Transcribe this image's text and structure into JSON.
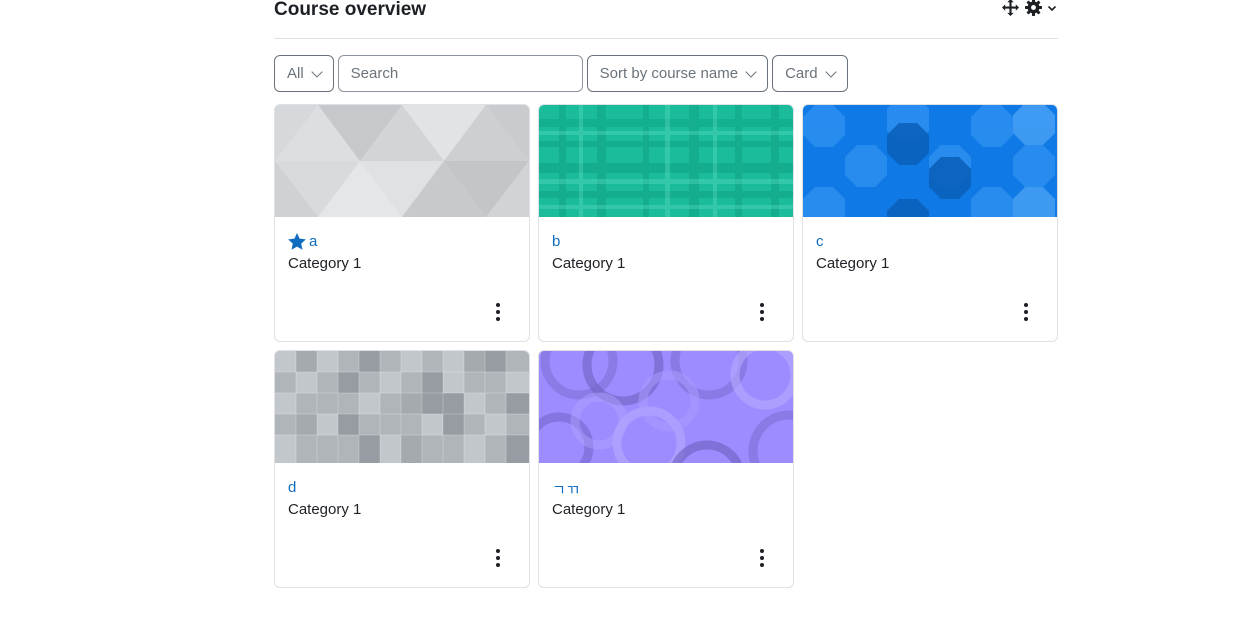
{
  "block": {
    "title": "Course overview",
    "controls": {
      "move_icon": "move-icon",
      "settings_icon": "gear-icon"
    }
  },
  "filters": {
    "grouping_label": "All",
    "search_placeholder": "Search",
    "sort_label": "Sort by course name",
    "view_label": "Card"
  },
  "courses": [
    {
      "name": "a",
      "category": "Category 1",
      "starred": true,
      "pattern": "triangles"
    },
    {
      "name": "b",
      "category": "Category 1",
      "starred": false,
      "pattern": "plaid"
    },
    {
      "name": "c",
      "category": "Category 1",
      "starred": false,
      "pattern": "octagons"
    },
    {
      "name": "d",
      "category": "Category 1",
      "starred": false,
      "pattern": "squares"
    },
    {
      "name": "ㄱㄲ",
      "category": "Category 1",
      "starred": false,
      "pattern": "circles"
    }
  ],
  "colors": {
    "link": "#0f6cbf",
    "text": "#1d2125",
    "border": "#dee2e6",
    "triangles_bg": "#d3d6d9",
    "plaid_bg": "#1abc9c",
    "octagons_bg": "#0f7ae5",
    "squares_bg": "#b0b5ba",
    "circles_bg": "#9b8cff"
  }
}
